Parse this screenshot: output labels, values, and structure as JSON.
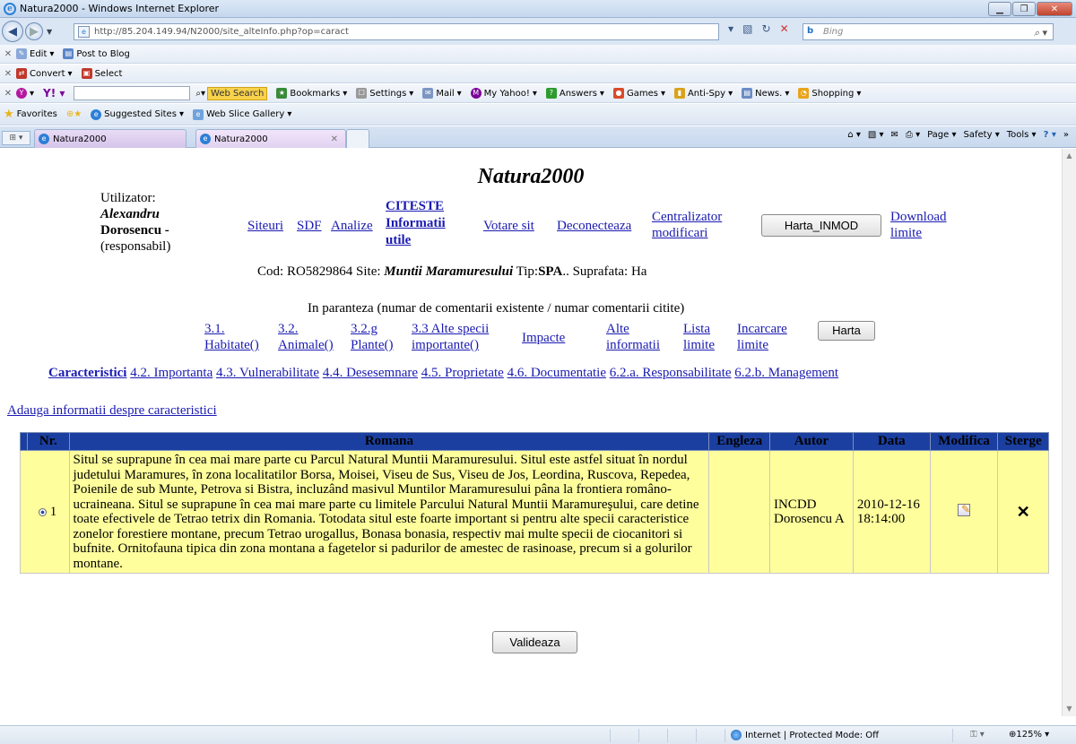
{
  "window": {
    "title": "Natura2000 - Windows Internet Explorer"
  },
  "address": {
    "url": "http://85.204.149.94/N2000/site_alteInfo.php?op=caract",
    "search_placeholder": "Bing"
  },
  "toolbar1": {
    "edit": "Edit",
    "post": "Post to Blog"
  },
  "toolbar2": {
    "convert": "Convert",
    "select": "Select"
  },
  "toolbar3": {
    "websearch": "Web Search",
    "bookmarks": "Bookmarks",
    "settings": "Settings",
    "mail": "Mail",
    "myyahoo": "My Yahoo!",
    "answers": "Answers",
    "games": "Games",
    "antispy": "Anti-Spy",
    "news": "News.",
    "shopping": "Shopping"
  },
  "favbar": {
    "favorites": "Favorites",
    "suggested": "Suggested Sites",
    "webslice": "Web Slice Gallery"
  },
  "tabs": [
    "Natura2000",
    "Natura2000"
  ],
  "commandbar": {
    "page": "Page",
    "safety": "Safety",
    "tools": "Tools"
  },
  "page": {
    "title": "Natura2000",
    "user_label": "Utilizator:",
    "user_first": "Alexandru",
    "user_last": "Dorosencu -",
    "user_role": "(responsabil)",
    "nav": {
      "siteuri": "Siteuri",
      "sdf": "SDF",
      "analize": "Analize",
      "citeste1": "CITESTE",
      "citeste2": "Informatii",
      "citeste3": "utile",
      "votare": "Votare  sit",
      "deconecteaza": "Deconecteaza",
      "centralizator1": "Centralizator",
      "centralizator2": "modificari",
      "harta_inmod": "Harta_INMOD",
      "download1": "Download",
      "download2": "limite"
    },
    "site_info": {
      "cod_label": "Cod:",
      "cod": "RO5829864",
      "site_label": "Site:",
      "site": "Muntii Maramuresului",
      "tip_label": "Tip:",
      "tip": "SPA",
      "suprafata": ".. Suprafata: Ha"
    },
    "paranteza": "In paranteza (numar de comentarii existente / numar comentarii citite)",
    "sections": {
      "s31a": "3.1.",
      "s31b": "Habitate()",
      "s32a": "3.2.",
      "s32b": "Animale()",
      "s32ga": "3.2.g",
      "s32gb": "Plante()",
      "s33a": "3.3 Alte specii",
      "s33b": "importante()",
      "impacte": "Impacte",
      "alte1": "Alte",
      "alte2": "informatii",
      "lista1": "Lista",
      "lista2": "limite",
      "incarcare1": "Incarcare",
      "incarcare2": "limite",
      "harta": "Harta"
    },
    "subtabs": [
      "Caracteristici",
      "4.2. Importanta",
      "4.3. Vulnerabilitate",
      "4.4. Desesemnare",
      "4.5. Proprietate",
      "4.6. Documentatie",
      "6.2.a. Responsabilitate",
      "6.2.b. Management"
    ],
    "add_link": "Adauga informatii despre caracteristici",
    "table": {
      "headers": [
        "Nr.",
        "Romana",
        "Engleza",
        "Autor",
        "Data",
        "Modifica",
        "Sterge"
      ],
      "rows": [
        {
          "nr": "1",
          "romana": "Situl se suprapune în cea mai mare parte cu Parcul Natural Muntii Maramuresului. Situl este astfel situat în nordul judetului Maramures, în zona localitatilor Borsa, Moisei, Viseu de Sus, Viseu de Jos, Leordina, Ruscova, Repedea, Poienile de sub Munte, Petrova si Bistra, incluzând masivul Muntilor Maramuresului pâna la frontiera româno-ucraineana. Situl se suprapune în cea mai mare parte cu limitele Parcului Natural Muntii Maramureşului, care detine toate efectivele de Tetrao tetrix din Romania. Totodata situl este foarte important si pentru alte specii caracteristice zonelor forestiere montane, precum Tetrao urogallus, Bonasa bonasia, respectiv mai multe specii de ciocanitori si bufnite. Ornitofauna tipica din zona montana a fagetelor si padurilor de amestec de rasinoase, precum si a golurilor montane.",
          "engleza": "",
          "autor": "INCDD Dorosencu A",
          "data": "2010-12-16 18:14:00"
        }
      ]
    },
    "valideaza": "Valideaza"
  },
  "status": {
    "zone": "Internet | Protected Mode: Off",
    "zoom": "125%"
  }
}
